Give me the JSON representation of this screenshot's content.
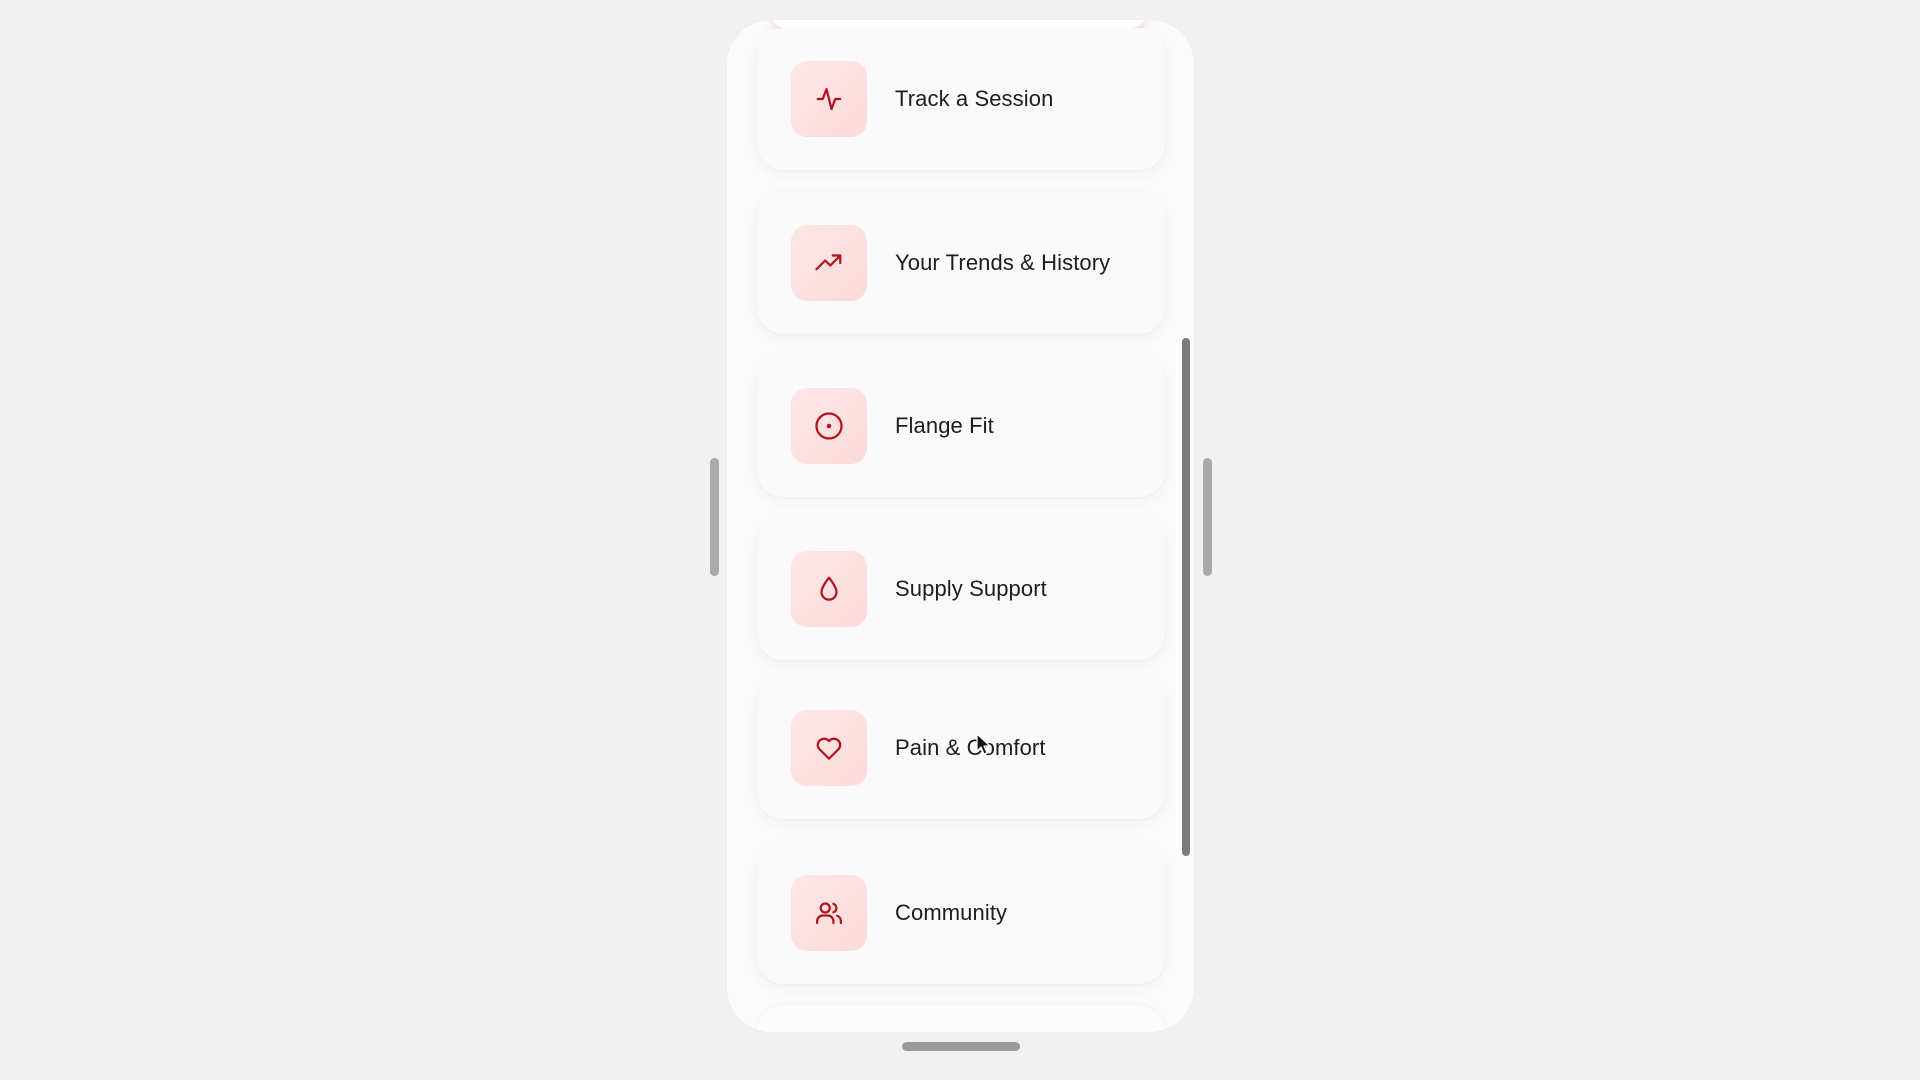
{
  "app": {
    "menu": [
      {
        "label": "Track a Session",
        "icon": "activity-icon"
      },
      {
        "label": "Your Trends & History",
        "icon": "trending-up-icon"
      },
      {
        "label": "Flange Fit",
        "icon": "target-icon"
      },
      {
        "label": "Supply Support",
        "icon": "droplet-icon"
      },
      {
        "label": "Pain & Comfort",
        "icon": "heart-icon"
      },
      {
        "label": "Community",
        "icon": "users-icon"
      }
    ]
  },
  "colors": {
    "accent": "#b3141b",
    "tile_background": "#fde7e7",
    "card_background": "#fafafa",
    "page_background": "#f1f1f1"
  }
}
